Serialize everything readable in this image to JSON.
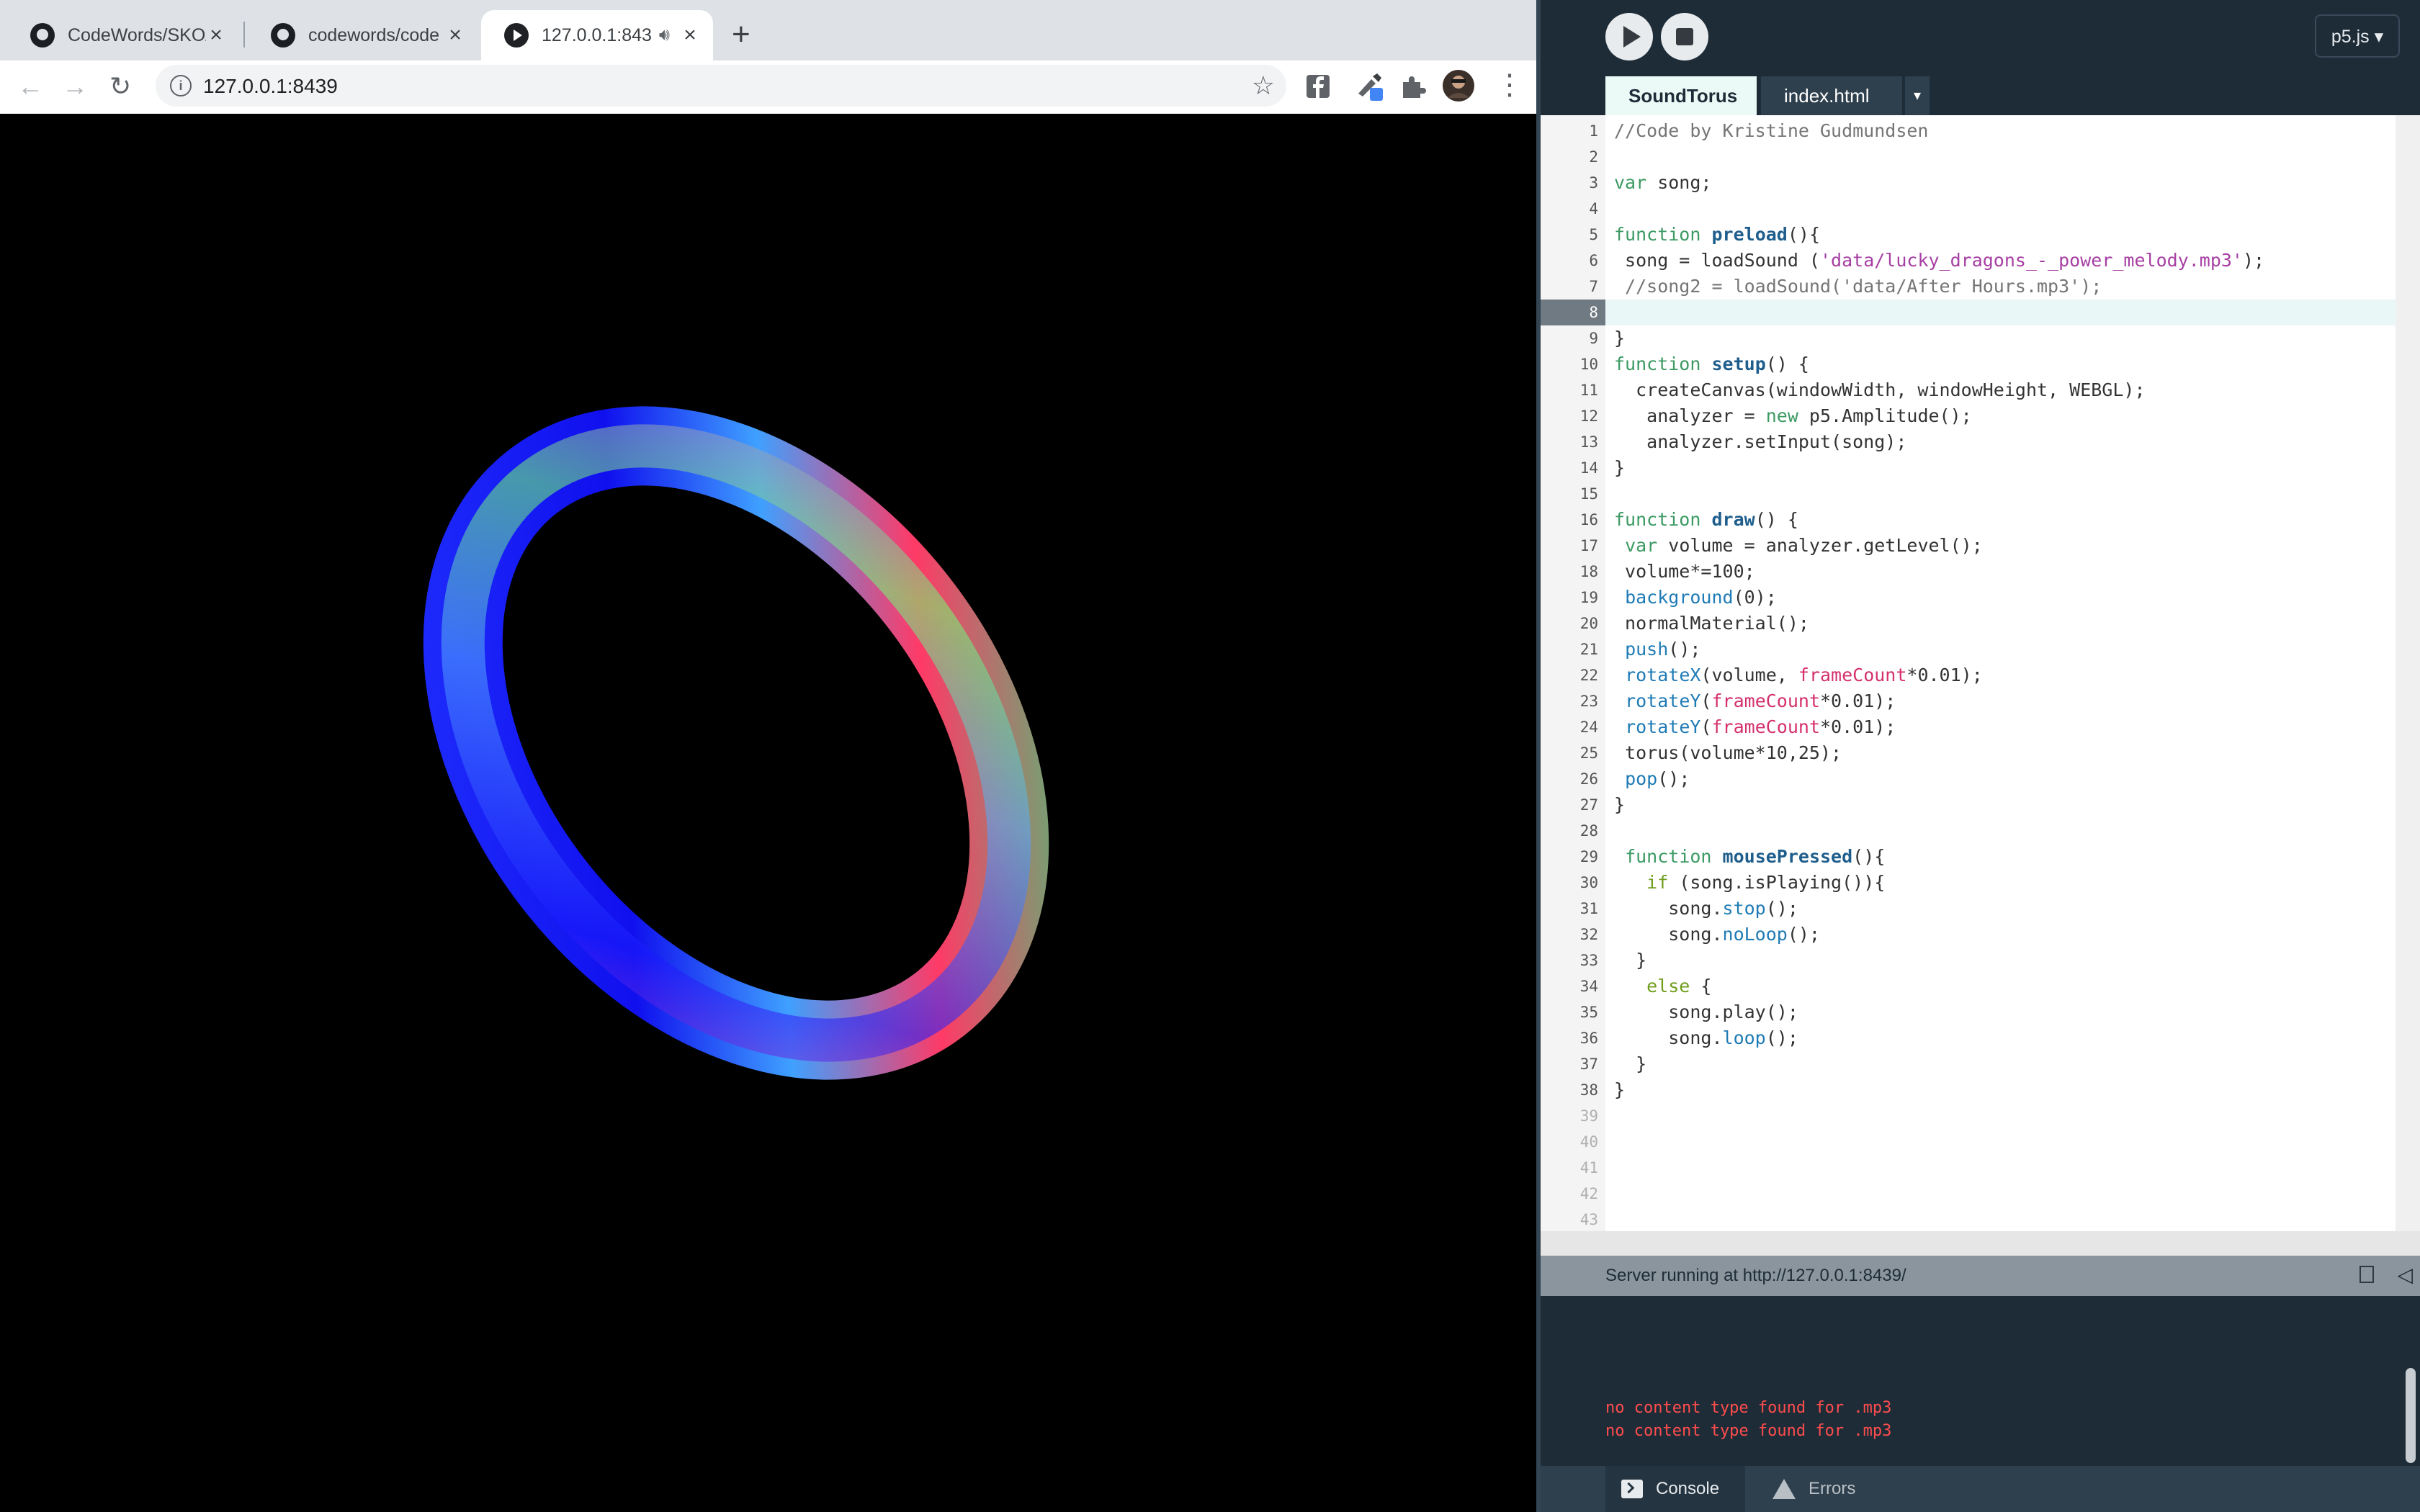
{
  "browser": {
    "tabs": [
      {
        "title": "CodeWords/SKO/",
        "favicon": "github-icon",
        "active": false
      },
      {
        "title": "codewords/code",
        "favicon": "github-icon",
        "active": false
      },
      {
        "title": "127.0.0.1:843",
        "favicon": "play-icon",
        "active": true,
        "audio": true
      }
    ],
    "new_tab_label": "+",
    "url": "127.0.0.1:8439",
    "toolbar_icons": [
      "back-arrow-icon",
      "forward-arrow-icon",
      "reload-icon",
      "info-icon",
      "star-icon",
      "facebook-extension-icon",
      "eyedropper-extension-icon",
      "puzzle-extensions-icon",
      "profile-avatar-icon",
      "more-menu-icon"
    ]
  },
  "editor": {
    "mode_label": "p5.js ▾",
    "tabs": [
      {
        "label": "SoundTorus",
        "active": true
      },
      {
        "label": "index.html",
        "active": false
      }
    ],
    "tab_more_label": "▾",
    "current_line": 8,
    "line_count": 43,
    "code_lines": [
      "//Code by Kristine Gudmundsen",
      "",
      "var song;",
      "",
      "function preload(){",
      " song = loadSound ('data/lucky_dragons_-_power_melody.mp3');",
      " //song2 = loadSound('data/After Hours.mp3');",
      "",
      "}",
      "function setup() {",
      "  createCanvas(windowWidth, windowHeight, WEBGL);",
      "   analyzer = new p5.Amplitude();",
      "   analyzer.setInput(song);",
      "}",
      "",
      "function draw() {",
      " var volume = analyzer.getLevel();",
      " volume*=100;",
      " background(0);",
      " normalMaterial();",
      " push();",
      " rotateX(volume, frameCount*0.01);",
      " rotateY(frameCount*0.01);",
      " rotateY(frameCount*0.01);",
      " torus(volume*10,25);",
      " pop();",
      "}",
      "",
      " function mousePressed(){",
      "   if (song.isPlaying()){",
      "     song.stop();",
      "     song.noLoop();",
      "  }",
      "   else {",
      "     song.play();",
      "     song.loop();",
      "  }",
      "}",
      "",
      "",
      "",
      "",
      ""
    ],
    "status_text": "Server running at http://127.0.0.1:8439/",
    "console_lines": [
      "no content type found for .mp3",
      "no content type found for .mp3"
    ],
    "bottom_tabs": {
      "console": "Console",
      "errors": "Errors"
    }
  }
}
